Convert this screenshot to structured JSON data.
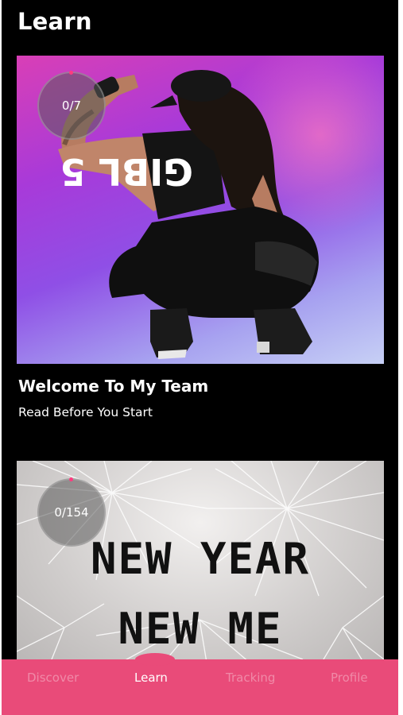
{
  "header": {
    "title": "Learn"
  },
  "cards": [
    {
      "progress": "0/7",
      "title": "Welcome To My Team",
      "subtitle": "Read Before You Start",
      "image": {
        "shirt_text": "GIBL 5"
      }
    },
    {
      "progress": "0/154",
      "image": {
        "banner_line1": "NEW YEAR",
        "banner_line2": "NEW ME"
      }
    }
  ],
  "nav": {
    "items": [
      {
        "label": "Discover",
        "active": false
      },
      {
        "label": "Learn",
        "active": true
      },
      {
        "label": "Tracking",
        "active": false
      },
      {
        "label": "Profile",
        "active": false
      }
    ]
  },
  "colors": {
    "background": "#000000",
    "nav_bar": "#e94b79",
    "accent_dot": "#ff3b7f",
    "nav_inactive": "rgba(255,255,255,0.35)"
  }
}
